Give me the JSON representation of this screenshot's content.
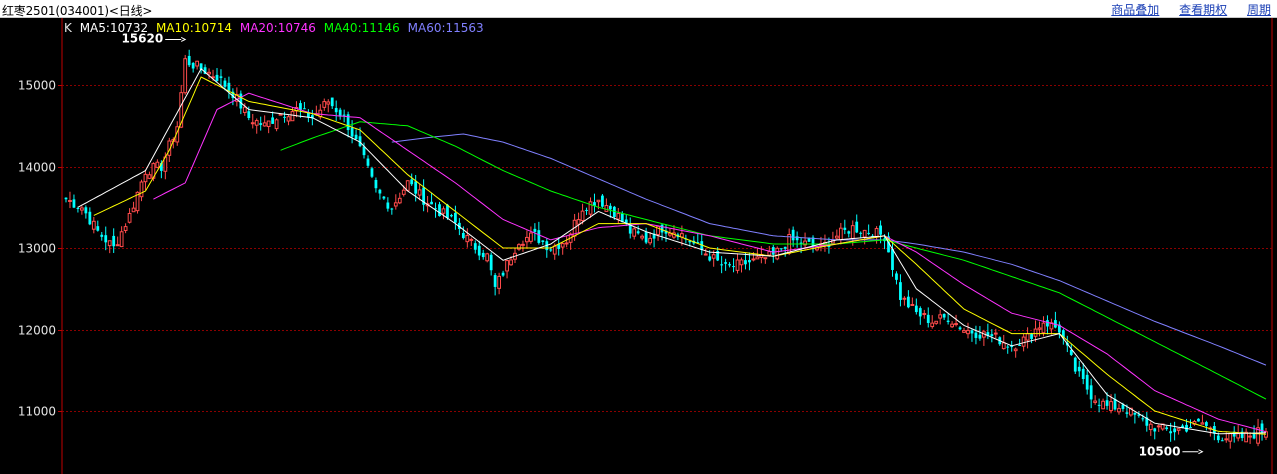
{
  "header": {
    "title": "红枣2501(034001)<日线>",
    "links": [
      "商品叠加",
      "查看期权",
      "周期"
    ]
  },
  "legend": {
    "k_label": "K",
    "ma5": "MA5:10732",
    "ma10": "MA10:10714",
    "ma20": "MA20:10746",
    "ma40": "MA40:11146",
    "ma60": "MA60:11563"
  },
  "colors": {
    "up": "#ff4b4b",
    "down": "#00ffff",
    "ma5": "#ffffff",
    "ma10": "#ffff00",
    "ma20": "#ff33ff",
    "ma40": "#00ff00",
    "ma60": "#8080ff",
    "grid": "#8b0000",
    "axis_text": "#e6e6e6"
  },
  "chart_data": {
    "type": "candlestick",
    "ylim": [
      10300,
      15750
    ],
    "yticks": [
      11000,
      12000,
      13000,
      14000,
      15000
    ],
    "grid": true,
    "high_marker": "15620",
    "low_marker": "10500",
    "anchors": [
      [
        0,
        13600
      ],
      [
        4,
        13500
      ],
      [
        8,
        13200
      ],
      [
        12,
        13000
      ],
      [
        16,
        13400
      ],
      [
        20,
        13950
      ],
      [
        24,
        14000
      ],
      [
        28,
        14500
      ],
      [
        30,
        15300
      ],
      [
        34,
        15200
      ],
      [
        38,
        15100
      ],
      [
        42,
        14900
      ],
      [
        46,
        14600
      ],
      [
        50,
        14500
      ],
      [
        54,
        14650
      ],
      [
        58,
        14700
      ],
      [
        62,
        14600
      ],
      [
        66,
        14800
      ],
      [
        70,
        14600
      ],
      [
        74,
        14200
      ],
      [
        78,
        13700
      ],
      [
        82,
        13500
      ],
      [
        86,
        13800
      ],
      [
        90,
        13600
      ],
      [
        94,
        13450
      ],
      [
        98,
        13300
      ],
      [
        102,
        13050
      ],
      [
        106,
        12900
      ],
      [
        108,
        12500
      ],
      [
        110,
        12700
      ],
      [
        114,
        13100
      ],
      [
        118,
        13150
      ],
      [
        122,
        13000
      ],
      [
        126,
        13100
      ],
      [
        130,
        13500
      ],
      [
        134,
        13600
      ],
      [
        138,
        13450
      ],
      [
        142,
        13200
      ],
      [
        146,
        13100
      ],
      [
        150,
        13250
      ],
      [
        154,
        13200
      ],
      [
        158,
        13050
      ],
      [
        162,
        12900
      ],
      [
        166,
        12750
      ],
      [
        170,
        12800
      ],
      [
        174,
        12850
      ],
      [
        178,
        12900
      ],
      [
        182,
        13100
      ],
      [
        186,
        13050
      ],
      [
        190,
        13000
      ],
      [
        194,
        13150
      ],
      [
        198,
        13250
      ],
      [
        202,
        13200
      ],
      [
        206,
        13150
      ],
      [
        210,
        12400
      ],
      [
        214,
        12200
      ],
      [
        218,
        12100
      ],
      [
        222,
        12150
      ],
      [
        226,
        12000
      ],
      [
        230,
        11950
      ],
      [
        234,
        11900
      ],
      [
        238,
        11800
      ],
      [
        242,
        11900
      ],
      [
        246,
        12100
      ],
      [
        250,
        12000
      ],
      [
        254,
        11500
      ],
      [
        258,
        11200
      ],
      [
        262,
        11050
      ],
      [
        266,
        11050
      ],
      [
        270,
        10900
      ],
      [
        274,
        10800
      ],
      [
        278,
        10750
      ],
      [
        282,
        10800
      ],
      [
        286,
        10850
      ],
      [
        290,
        10700
      ],
      [
        294,
        10650
      ],
      [
        298,
        10700
      ],
      [
        302,
        10780
      ]
    ],
    "ma_anchors": {
      "ma5": [
        [
          3,
          13500
        ],
        [
          20,
          13950
        ],
        [
          34,
          15200
        ],
        [
          46,
          14700
        ],
        [
          62,
          14600
        ],
        [
          74,
          14300
        ],
        [
          86,
          13700
        ],
        [
          98,
          13300
        ],
        [
          110,
          12850
        ],
        [
          122,
          13050
        ],
        [
          134,
          13450
        ],
        [
          146,
          13200
        ],
        [
          162,
          12950
        ],
        [
          178,
          12900
        ],
        [
          194,
          13100
        ],
        [
          206,
          13150
        ],
        [
          214,
          12500
        ],
        [
          226,
          12050
        ],
        [
          238,
          11800
        ],
        [
          250,
          11950
        ],
        [
          262,
          11200
        ],
        [
          274,
          10850
        ],
        [
          290,
          10720
        ],
        [
          302,
          10732
        ]
      ],
      "ma10": [
        [
          7,
          13400
        ],
        [
          20,
          13700
        ],
        [
          26,
          14200
        ],
        [
          34,
          15100
        ],
        [
          46,
          14800
        ],
        [
          62,
          14650
        ],
        [
          74,
          14450
        ],
        [
          86,
          13900
        ],
        [
          98,
          13450
        ],
        [
          110,
          13000
        ],
        [
          122,
          13000
        ],
        [
          134,
          13300
        ],
        [
          146,
          13300
        ],
        [
          162,
          13000
        ],
        [
          178,
          12900
        ],
        [
          194,
          13050
        ],
        [
          206,
          13150
        ],
        [
          214,
          12800
        ],
        [
          226,
          12250
        ],
        [
          238,
          11950
        ],
        [
          250,
          11950
        ],
        [
          262,
          11450
        ],
        [
          274,
          11000
        ],
        [
          290,
          10750
        ],
        [
          302,
          10714
        ]
      ],
      "ma20": [
        [
          22,
          13600
        ],
        [
          30,
          13800
        ],
        [
          38,
          14700
        ],
        [
          46,
          14900
        ],
        [
          62,
          14650
        ],
        [
          74,
          14600
        ],
        [
          86,
          14200
        ],
        [
          98,
          13800
        ],
        [
          110,
          13350
        ],
        [
          122,
          13100
        ],
        [
          134,
          13250
        ],
        [
          146,
          13300
        ],
        [
          162,
          13150
        ],
        [
          178,
          12950
        ],
        [
          194,
          13050
        ],
        [
          206,
          13150
        ],
        [
          214,
          12950
        ],
        [
          226,
          12550
        ],
        [
          238,
          12200
        ],
        [
          250,
          12050
        ],
        [
          262,
          11700
        ],
        [
          274,
          11250
        ],
        [
          290,
          10900
        ],
        [
          302,
          10746
        ]
      ],
      "ma40": [
        [
          54,
          14200
        ],
        [
          62,
          14350
        ],
        [
          74,
          14550
        ],
        [
          86,
          14500
        ],
        [
          98,
          14250
        ],
        [
          110,
          13950
        ],
        [
          122,
          13700
        ],
        [
          134,
          13500
        ],
        [
          146,
          13350
        ],
        [
          162,
          13150
        ],
        [
          178,
          13050
        ],
        [
          194,
          13050
        ],
        [
          206,
          13100
        ],
        [
          214,
          13000
        ],
        [
          226,
          12850
        ],
        [
          238,
          12650
        ],
        [
          250,
          12450
        ],
        [
          262,
          12150
        ],
        [
          274,
          11850
        ],
        [
          290,
          11450
        ],
        [
          302,
          11146
        ]
      ],
      "ma60": [
        [
          82,
          14300
        ],
        [
          90,
          14350
        ],
        [
          100,
          14400
        ],
        [
          110,
          14300
        ],
        [
          122,
          14100
        ],
        [
          134,
          13850
        ],
        [
          146,
          13600
        ],
        [
          162,
          13300
        ],
        [
          178,
          13150
        ],
        [
          194,
          13100
        ],
        [
          206,
          13100
        ],
        [
          214,
          13050
        ],
        [
          226,
          12950
        ],
        [
          238,
          12800
        ],
        [
          250,
          12600
        ],
        [
          262,
          12350
        ],
        [
          274,
          12100
        ],
        [
          290,
          11800
        ],
        [
          302,
          11563
        ]
      ]
    }
  }
}
